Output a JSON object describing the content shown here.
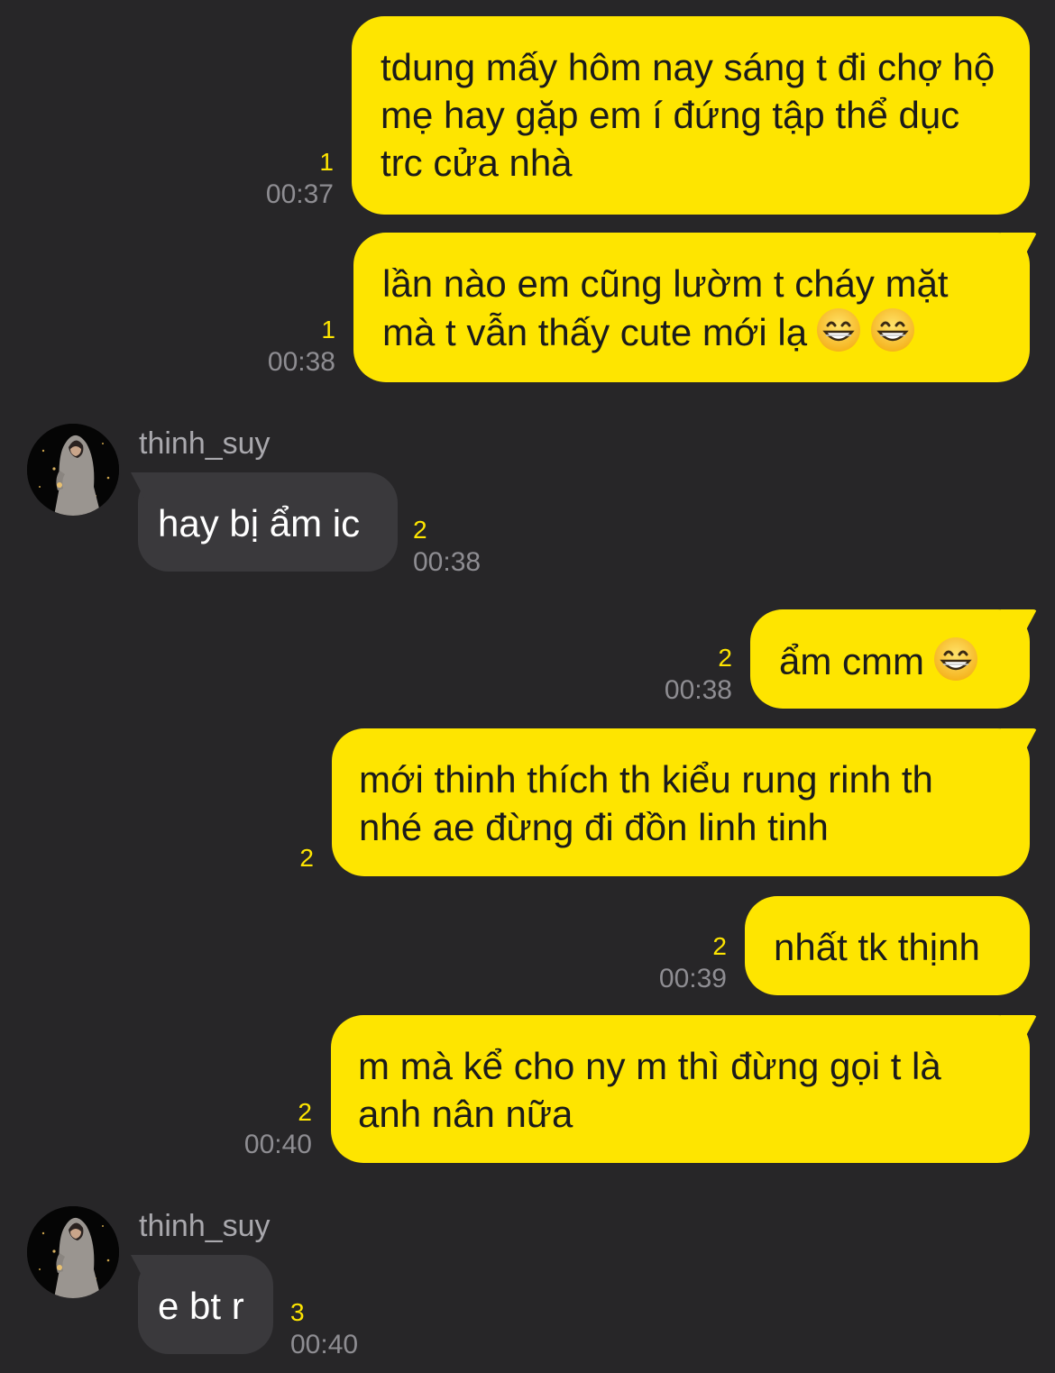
{
  "colors": {
    "background": "#272628",
    "sent_bubble": "#FEE500",
    "received_bubble": "#3a393c",
    "unread_count": "#FEE500",
    "timestamp": "#8e8d92"
  },
  "messages": [
    {
      "direction": "sent",
      "text": "tdung mấy hôm nay sáng t đi chợ hộ mẹ hay gặp em í đứng tập thể dục trc cửa nhà",
      "unread": "1",
      "time": "00:37"
    },
    {
      "direction": "sent",
      "text": "lần nào em cũng lườm t cháy mặt mà t vẫn thấy cute mới lạ",
      "emojis": [
        "grinning-face-icon",
        "grinning-face-icon"
      ],
      "unread": "1",
      "time": "00:38"
    },
    {
      "direction": "received",
      "sender": "thinh_suy",
      "avatar": "user-avatar-icon",
      "text": "hay bị ẩm ic",
      "unread": "2",
      "time": "00:38"
    },
    {
      "direction": "sent",
      "text": "ẩm cmm",
      "emojis": [
        "grinning-face-icon"
      ],
      "unread": "2",
      "time": "00:38"
    },
    {
      "direction": "sent",
      "text": "mới thinh thích th kiểu rung rinh th nhé ae đừng đi đồn linh tinh",
      "unread": "2",
      "time": ""
    },
    {
      "direction": "sent",
      "text": "nhất tk thịnh",
      "unread": "2",
      "time": "00:39"
    },
    {
      "direction": "sent",
      "text": "m mà kể cho ny m thì đừng gọi t là anh nân nữa",
      "unread": "2",
      "time": "00:40"
    },
    {
      "direction": "received",
      "sender": "thinh_suy",
      "avatar": "user-avatar-icon",
      "text": "e bt r",
      "unread": "3",
      "time": "00:40"
    }
  ]
}
